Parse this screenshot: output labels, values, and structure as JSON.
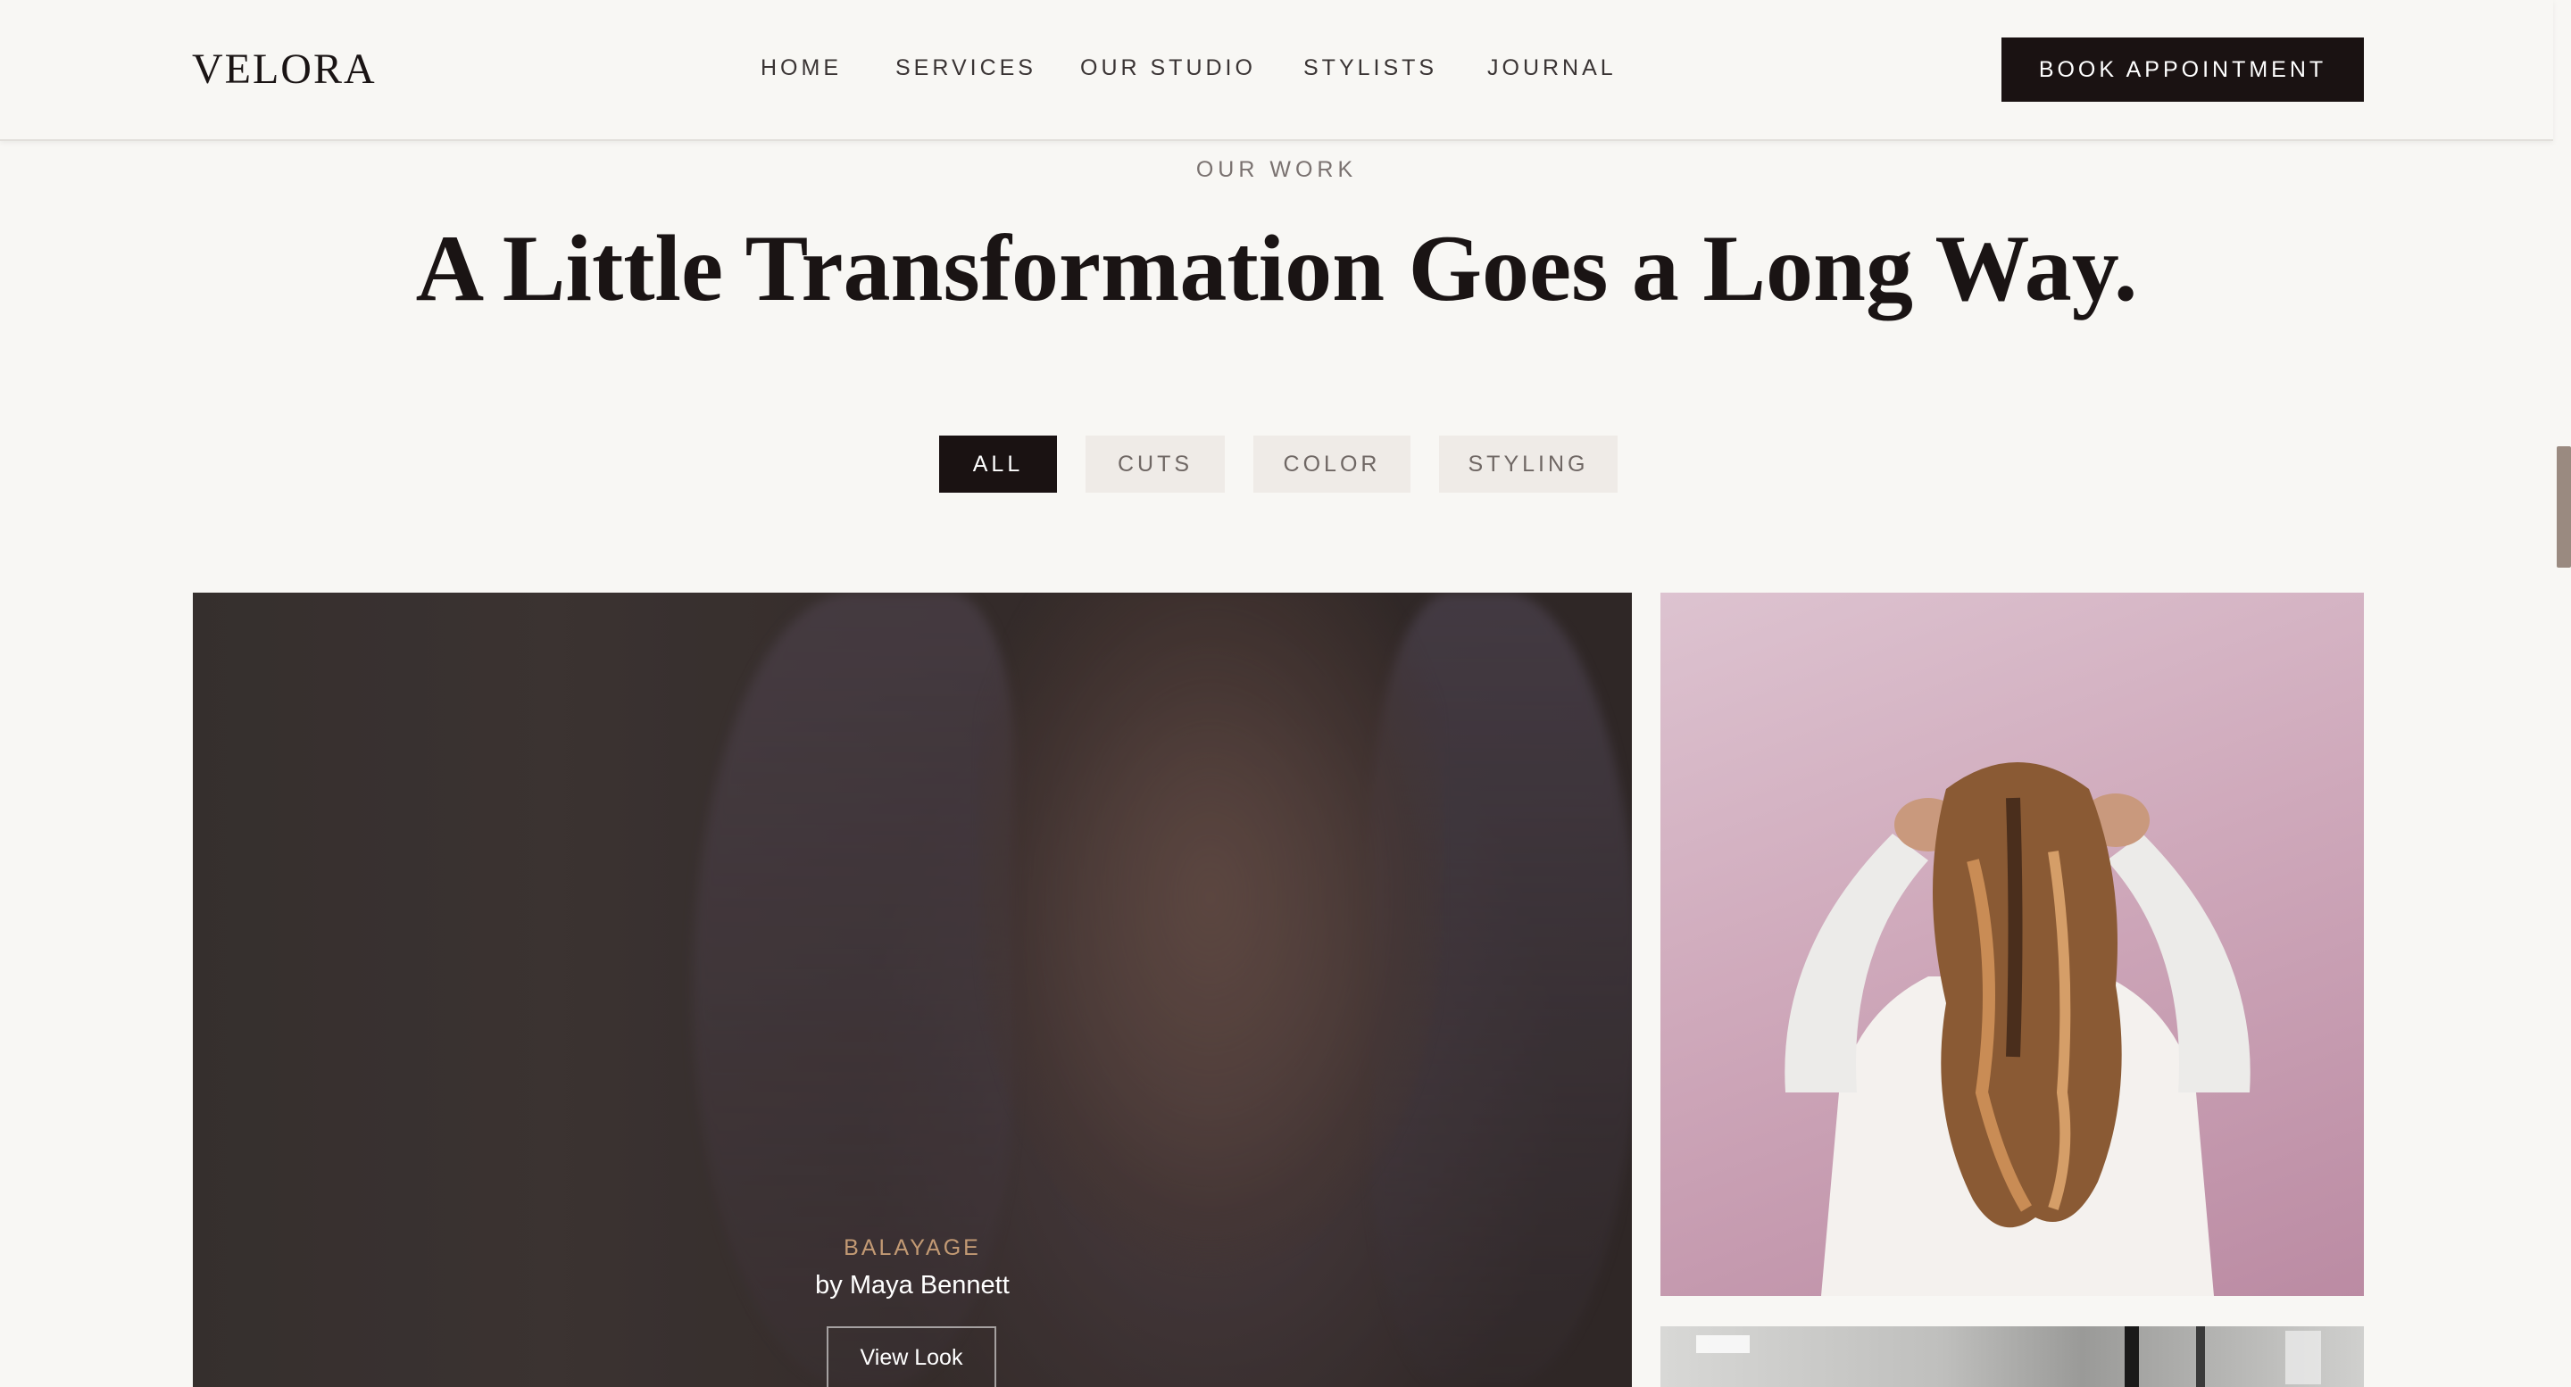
{
  "header": {
    "logo": "VELORA",
    "nav": [
      {
        "label": "HOME"
      },
      {
        "label": "SERVICES"
      },
      {
        "label": "OUR STUDIO"
      },
      {
        "label": "STYLISTS"
      },
      {
        "label": "JOURNAL"
      }
    ],
    "cta_label": "BOOK APPOINTMENT"
  },
  "section": {
    "eyebrow": "OUR WORK",
    "headline": "A Little Transformation Goes a Long Way."
  },
  "filters": [
    {
      "label": "ALL",
      "active": true
    },
    {
      "label": "CUTS",
      "active": false
    },
    {
      "label": "COLOR",
      "active": false
    },
    {
      "label": "STYLING",
      "active": false
    }
  ],
  "gallery": {
    "featured": {
      "category": "BALAYAGE",
      "byline": "by Maya Bennett",
      "button_label": "View Look"
    }
  },
  "colors": {
    "background": "#f8f7f4",
    "dark": "#1a1212",
    "accent": "#c39a74",
    "filter_inactive_bg": "#efebe7"
  }
}
